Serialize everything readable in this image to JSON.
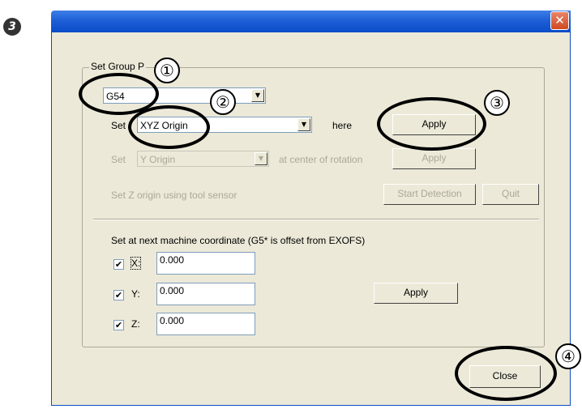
{
  "step_marker": "3",
  "titlebar": {
    "close_glyph": "✕"
  },
  "group": {
    "label": "Set Group P"
  },
  "work_coordinate": {
    "value": "G54"
  },
  "row_origin": {
    "prefix": "Set",
    "combo_value": "XYZ Origin",
    "suffix": "here",
    "apply_label": "Apply"
  },
  "row_rotation": {
    "prefix": "Set",
    "combo_value": "Y Origin",
    "suffix": "at center of rotation",
    "apply_label": "Apply"
  },
  "row_sensor": {
    "label": "Set Z origin using tool sensor",
    "start_label": "Start Detection",
    "quit_label": "Quit"
  },
  "machine_coord": {
    "label": "Set at next machine coordinate  (G5* is offset from EXOFS)",
    "axes": [
      {
        "label": "X:",
        "checked": true,
        "value": "0.000"
      },
      {
        "label": "Y:",
        "checked": true,
        "value": "0.000"
      },
      {
        "label": "Z:",
        "checked": true,
        "value": "0.000"
      }
    ],
    "apply_label": "Apply"
  },
  "close_label": "Close",
  "callouts": [
    "①",
    "②",
    "③",
    "④"
  ],
  "check_glyph": "✔",
  "combo_arrow": "▼"
}
